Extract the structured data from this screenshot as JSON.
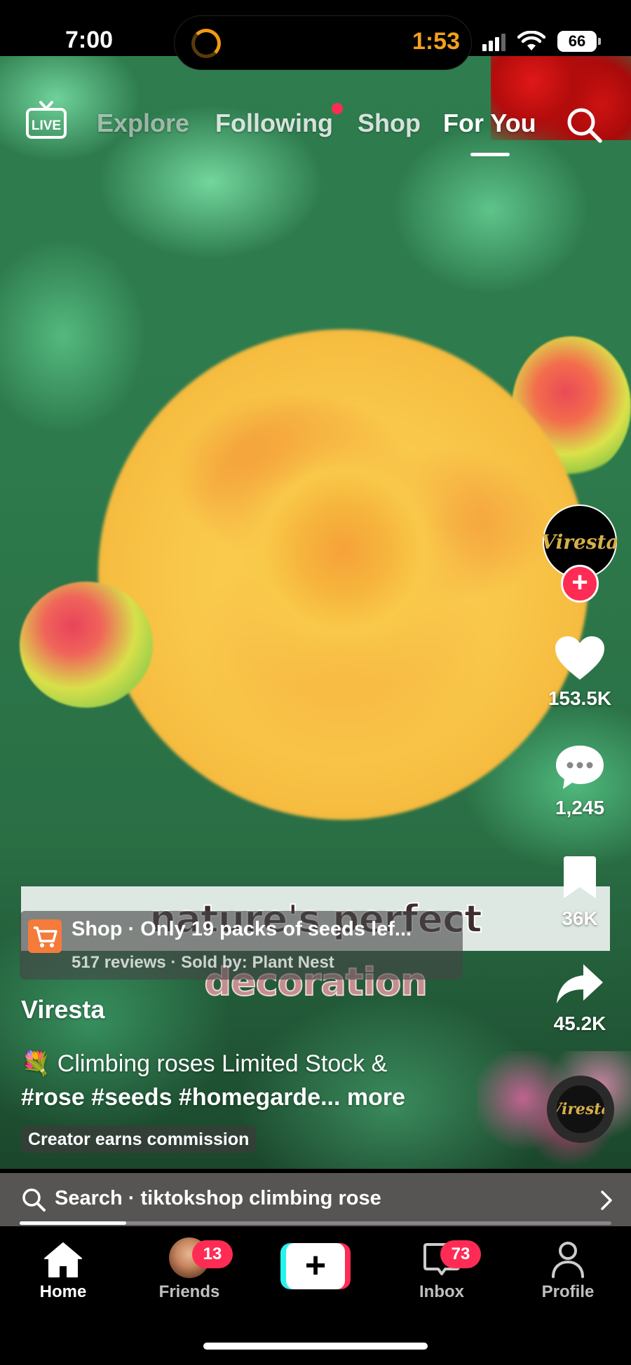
{
  "status_bar": {
    "time": "7:00",
    "timer": "1:53",
    "battery": "66"
  },
  "top_tabs": {
    "live_label": "LIVE",
    "tabs": [
      "Explore",
      "Following",
      "Shop",
      "For You"
    ],
    "active_tab": "For You",
    "following_has_dot": true
  },
  "video_caption": {
    "line1": "nature's perfect",
    "line2": "decoration"
  },
  "creator": {
    "avatar_text": "Viresta",
    "username": "Viresta"
  },
  "actions": {
    "likes": "153.5K",
    "comments": "1,245",
    "saves": "36K",
    "shares": "45.2K"
  },
  "shop_anchor": {
    "title": "Shop · Only 19 packs of seeds lef...",
    "subtitle": "517 reviews · Sold by: Plant Nest"
  },
  "post": {
    "emoji": "💐",
    "description_line1": "Climbing roses Limited Stock &",
    "hashtags": "#rose #seeds #homegarde...",
    "more": "more",
    "commission_label": "Creator earns commission"
  },
  "search_bar": {
    "label": "Search · tiktokshop climbing rose"
  },
  "playback_progress": 0.18,
  "bottom_nav": {
    "home": "Home",
    "friends": "Friends",
    "friends_badge": "13",
    "create": "+",
    "inbox": "Inbox",
    "inbox_badge": "73",
    "profile": "Profile"
  },
  "colors": {
    "accent_red": "#fe2c55",
    "accent_cyan": "#25f4ee",
    "timer_orange": "#f2a01f",
    "cart_orange": "#f47b3a"
  },
  "music_disc_text": "Viresta"
}
